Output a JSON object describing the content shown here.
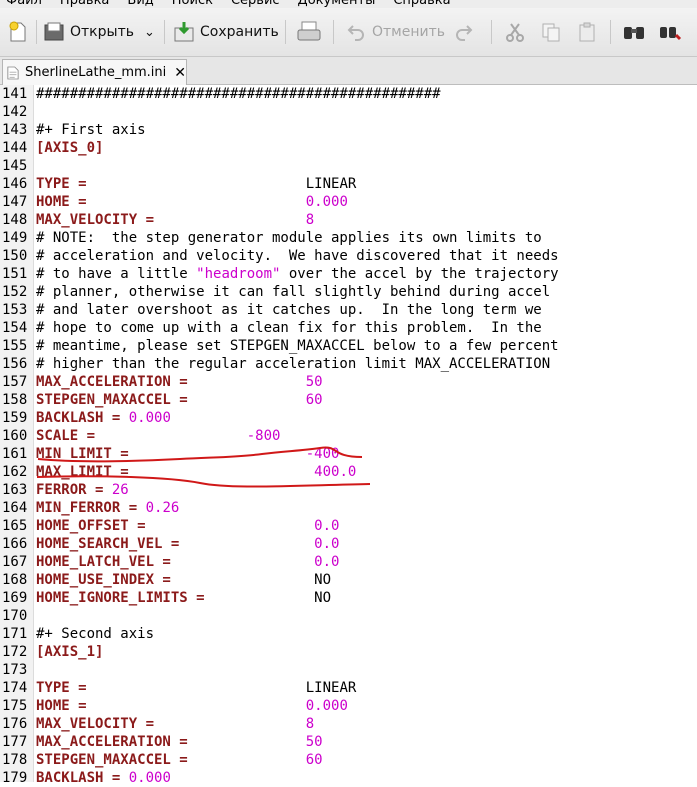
{
  "menu": [
    "Файл",
    "Правка",
    "Вид",
    "Поиск",
    "Сервис",
    "Документы",
    "Справка"
  ],
  "toolbar": {
    "open_label": "Открыть",
    "save_label": "Сохранить",
    "undo_label": "Отменить"
  },
  "tab": {
    "filename": "SherlineLathe_mm.ini",
    "close_glyph": "✕"
  },
  "lines": [
    {
      "n": "141",
      "parts": [
        {
          "t": "c",
          "v": "################################################"
        }
      ]
    },
    {
      "n": "142",
      "parts": []
    },
    {
      "n": "143",
      "parts": [
        {
          "t": "c",
          "v": "#+ First axis"
        }
      ]
    },
    {
      "n": "144",
      "parts": [
        {
          "t": "sec",
          "v": "[AXIS_0]"
        }
      ]
    },
    {
      "n": "145",
      "parts": []
    },
    {
      "n": "146",
      "parts": [
        {
          "t": "k",
          "v": "TYPE ="
        },
        {
          "t": "p",
          "v": "                          "
        },
        {
          "t": "plain",
          "v": "LINEAR"
        }
      ]
    },
    {
      "n": "147",
      "parts": [
        {
          "t": "k",
          "v": "HOME ="
        },
        {
          "t": "p",
          "v": "                          "
        },
        {
          "t": "v",
          "v": "0.000"
        }
      ]
    },
    {
      "n": "148",
      "parts": [
        {
          "t": "k",
          "v": "MAX_VELOCITY ="
        },
        {
          "t": "p",
          "v": "                  "
        },
        {
          "t": "v",
          "v": "8"
        }
      ]
    },
    {
      "n": "149",
      "parts": [
        {
          "t": "c",
          "v": "# NOTE:  the step generator module applies its own limits to"
        }
      ]
    },
    {
      "n": "150",
      "parts": [
        {
          "t": "c",
          "v": "# acceleration and velocity.  We have discovered that it needs"
        }
      ]
    },
    {
      "n": "151",
      "parts": [
        {
          "t": "c",
          "v": "# to have a little "
        },
        {
          "t": "s",
          "v": "\"headroom\""
        },
        {
          "t": "c",
          "v": " over the accel by the trajectory"
        }
      ]
    },
    {
      "n": "152",
      "parts": [
        {
          "t": "c",
          "v": "# planner, otherwise it can fall slightly behind during accel"
        }
      ]
    },
    {
      "n": "153",
      "parts": [
        {
          "t": "c",
          "v": "# and later overshoot as it catches up.  In the long term we"
        }
      ]
    },
    {
      "n": "154",
      "parts": [
        {
          "t": "c",
          "v": "# hope to come up with a clean fix for this problem.  In the"
        }
      ]
    },
    {
      "n": "155",
      "parts": [
        {
          "t": "c",
          "v": "# meantime, please set STEPGEN_MAXACCEL below to a few percent"
        }
      ]
    },
    {
      "n": "156",
      "parts": [
        {
          "t": "c",
          "v": "# higher than the regular acceleration limit MAX_ACCELERATION"
        }
      ]
    },
    {
      "n": "157",
      "parts": [
        {
          "t": "k",
          "v": "MAX_ACCELERATION ="
        },
        {
          "t": "p",
          "v": "              "
        },
        {
          "t": "v",
          "v": "50"
        }
      ]
    },
    {
      "n": "158",
      "parts": [
        {
          "t": "k",
          "v": "STEPGEN_MAXACCEL ="
        },
        {
          "t": "p",
          "v": "              "
        },
        {
          "t": "v",
          "v": "60"
        }
      ]
    },
    {
      "n": "159",
      "parts": [
        {
          "t": "k",
          "v": "BACKLASH ="
        },
        {
          "t": "p",
          "v": " "
        },
        {
          "t": "v",
          "v": "0.000"
        }
      ]
    },
    {
      "n": "160",
      "parts": [
        {
          "t": "k",
          "v": "SCALE ="
        },
        {
          "t": "p",
          "v": "                  "
        },
        {
          "t": "v",
          "v": "-800"
        }
      ]
    },
    {
      "n": "161",
      "parts": [
        {
          "t": "k",
          "v": "MIN_LIMIT ="
        },
        {
          "t": "p",
          "v": "                     "
        },
        {
          "t": "v",
          "v": "-400"
        }
      ]
    },
    {
      "n": "162",
      "parts": [
        {
          "t": "k",
          "v": "MAX_LIMIT ="
        },
        {
          "t": "p",
          "v": "                      "
        },
        {
          "t": "v",
          "v": "400.0"
        }
      ]
    },
    {
      "n": "163",
      "parts": [
        {
          "t": "k",
          "v": "FERROR ="
        },
        {
          "t": "p",
          "v": " "
        },
        {
          "t": "v",
          "v": "26"
        }
      ]
    },
    {
      "n": "164",
      "parts": [
        {
          "t": "k",
          "v": "MIN_FERROR ="
        },
        {
          "t": "p",
          "v": " "
        },
        {
          "t": "v",
          "v": "0.26"
        }
      ]
    },
    {
      "n": "165",
      "parts": [
        {
          "t": "k",
          "v": "HOME_OFFSET ="
        },
        {
          "t": "p",
          "v": "                    "
        },
        {
          "t": "v",
          "v": "0.0"
        }
      ]
    },
    {
      "n": "166",
      "parts": [
        {
          "t": "k",
          "v": "HOME_SEARCH_VEL ="
        },
        {
          "t": "p",
          "v": "                "
        },
        {
          "t": "v",
          "v": "0.0"
        }
      ]
    },
    {
      "n": "167",
      "parts": [
        {
          "t": "k",
          "v": "HOME_LATCH_VEL ="
        },
        {
          "t": "p",
          "v": "                 "
        },
        {
          "t": "v",
          "v": "0.0"
        }
      ]
    },
    {
      "n": "168",
      "parts": [
        {
          "t": "k",
          "v": "HOME_USE_INDEX ="
        },
        {
          "t": "p",
          "v": "                 "
        },
        {
          "t": "plain",
          "v": "NO"
        }
      ]
    },
    {
      "n": "169",
      "parts": [
        {
          "t": "k",
          "v": "HOME_IGNORE_LIMITS ="
        },
        {
          "t": "p",
          "v": "             "
        },
        {
          "t": "plain",
          "v": "NO"
        }
      ]
    },
    {
      "n": "170",
      "parts": []
    },
    {
      "n": "171",
      "parts": [
        {
          "t": "c",
          "v": "#+ Second axis"
        }
      ]
    },
    {
      "n": "172",
      "parts": [
        {
          "t": "sec",
          "v": "[AXIS_1]"
        }
      ]
    },
    {
      "n": "173",
      "parts": []
    },
    {
      "n": "174",
      "parts": [
        {
          "t": "k",
          "v": "TYPE ="
        },
        {
          "t": "p",
          "v": "                          "
        },
        {
          "t": "plain",
          "v": "LINEAR"
        }
      ]
    },
    {
      "n": "175",
      "parts": [
        {
          "t": "k",
          "v": "HOME ="
        },
        {
          "t": "p",
          "v": "                          "
        },
        {
          "t": "v",
          "v": "0.000"
        }
      ]
    },
    {
      "n": "176",
      "parts": [
        {
          "t": "k",
          "v": "MAX_VELOCITY ="
        },
        {
          "t": "p",
          "v": "                  "
        },
        {
          "t": "v",
          "v": "8"
        }
      ]
    },
    {
      "n": "177",
      "parts": [
        {
          "t": "k",
          "v": "MAX_ACCELERATION ="
        },
        {
          "t": "p",
          "v": "              "
        },
        {
          "t": "v",
          "v": "50"
        }
      ]
    },
    {
      "n": "178",
      "parts": [
        {
          "t": "k",
          "v": "STEPGEN_MAXACCEL ="
        },
        {
          "t": "p",
          "v": "              "
        },
        {
          "t": "v",
          "v": "60"
        }
      ]
    },
    {
      "n": "179",
      "parts": [
        {
          "t": "k",
          "v": "BACKLASH ="
        },
        {
          "t": "p",
          "v": " "
        },
        {
          "t": "v",
          "v": "0.000"
        }
      ]
    }
  ],
  "colors": {
    "key": "#8b1a1a",
    "value": "#cc00cc",
    "annotation": "#d01818"
  }
}
